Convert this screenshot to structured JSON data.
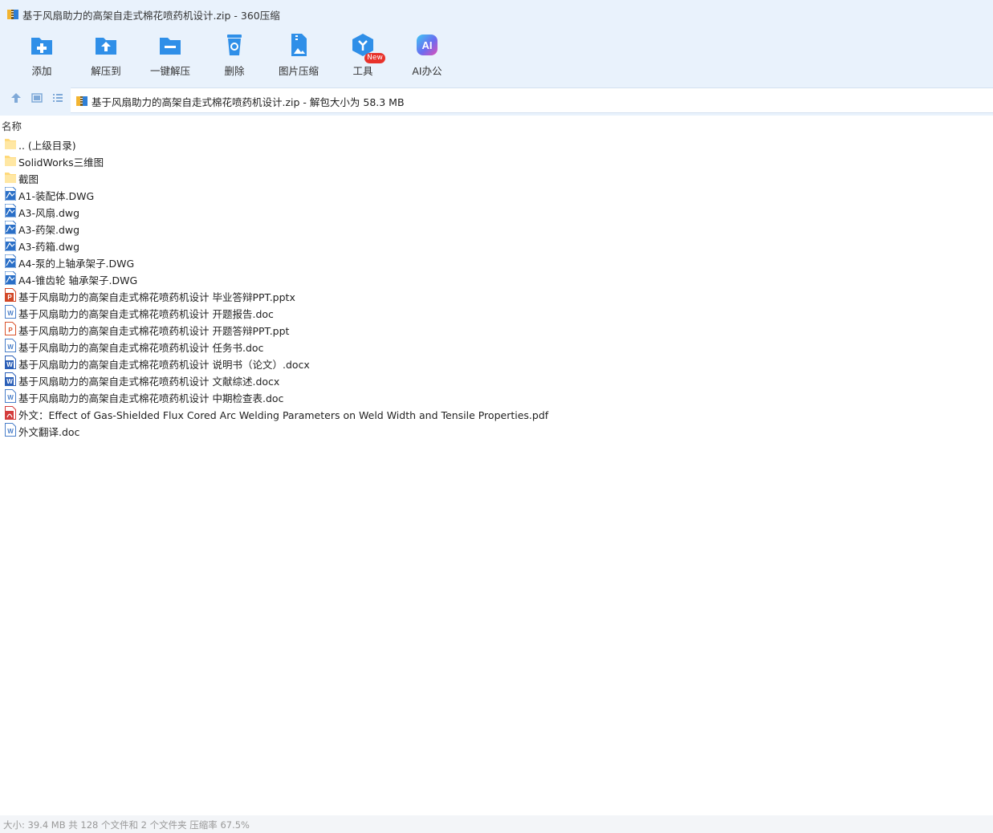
{
  "window": {
    "title": "基于风扇助力的高架自走式棉花喷药机设计.zip - 360压缩",
    "app_icon": "zip-archive-icon"
  },
  "toolbar": {
    "buttons": [
      {
        "label": "添加",
        "icon": "add-folder-icon"
      },
      {
        "label": "解压到",
        "icon": "extract-to-icon"
      },
      {
        "label": "一键解压",
        "icon": "one-click-extract-icon"
      },
      {
        "label": "删除",
        "icon": "recycle-bin-icon"
      },
      {
        "label": "图片压缩",
        "icon": "image-compress-icon"
      },
      {
        "label": "工具",
        "icon": "tools-icon"
      },
      {
        "label": "AI办公",
        "icon": "ai-office-icon"
      }
    ],
    "badge": "New"
  },
  "address": {
    "path": "基于风扇助力的高架自走式棉花喷药机设计.zip - 解包大小为 58.3 MB"
  },
  "list": {
    "column": "名称",
    "files": [
      {
        "name": ".. (上级目录)",
        "type": "folder"
      },
      {
        "name": "SolidWorks三维图",
        "type": "folder"
      },
      {
        "name": "截图",
        "type": "folder"
      },
      {
        "name": "A1-装配体.DWG",
        "type": "dwg"
      },
      {
        "name": "A3-风扇.dwg",
        "type": "dwg"
      },
      {
        "name": "A3-药架.dwg",
        "type": "dwg"
      },
      {
        "name": "A3-药箱.dwg",
        "type": "dwg"
      },
      {
        "name": "A4-泵的上轴承架子.DWG",
        "type": "dwg"
      },
      {
        "name": "A4-锥齿轮  轴承架子.DWG",
        "type": "dwg"
      },
      {
        "name": "基于风扇助力的高架自走式棉花喷药机设计 毕业答辩PPT.pptx",
        "type": "pptx"
      },
      {
        "name": "基于风扇助力的高架自走式棉花喷药机设计 开题报告.doc",
        "type": "doc"
      },
      {
        "name": "基于风扇助力的高架自走式棉花喷药机设计 开题答辩PPT.ppt",
        "type": "ppt"
      },
      {
        "name": "基于风扇助力的高架自走式棉花喷药机设计 任务书.doc",
        "type": "doc"
      },
      {
        "name": "基于风扇助力的高架自走式棉花喷药机设计 说明书（论文）.docx",
        "type": "docx"
      },
      {
        "name": "基于风扇助力的高架自走式棉花喷药机设计 文献综述.docx",
        "type": "docx"
      },
      {
        "name": "基于风扇助力的高架自走式棉花喷药机设计 中期检查表.doc",
        "type": "doc"
      },
      {
        "name": "外文：Effect of Gas-Shielded Flux Cored Arc Welding Parameters on Weld Width and Tensile Properties.pdf",
        "type": "pdf"
      },
      {
        "name": "外文翻译.doc",
        "type": "doc"
      }
    ]
  },
  "status": {
    "text": "大小: 39.4 MB 共 128 个文件和 2 个文件夹 压缩率 67.5%"
  },
  "colors": {
    "toolbar_bg": "#e9f2fc",
    "icon_blue": "#2f8fe8",
    "badge_red": "#e8322b"
  }
}
